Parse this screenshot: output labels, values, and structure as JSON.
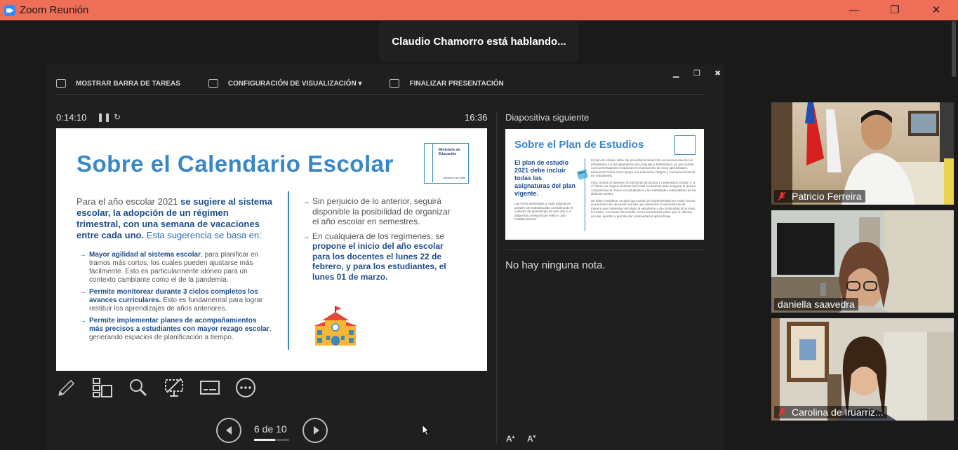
{
  "window": {
    "title": "Zoom Reunión",
    "minimize": "—",
    "restore": "❐",
    "close": "✕"
  },
  "speaking_banner": "Claudio Chamorro está hablando...",
  "presenter_toolbar": {
    "show_taskbar": "MOSTRAR BARRA DE TAREAS",
    "display_settings": "CONFIGURACIÓN DE VISUALIZACIÓN ▾",
    "end_presentation": "FINALIZAR PRESENTACIÓN"
  },
  "timer": "0:14:10",
  "clock": "16:36",
  "next_slide_label": "Diapositiva siguiente",
  "current_slide": {
    "title": "Sobre el Calendario Escolar",
    "gov_line1": "Ministerio de",
    "gov_line2": "Educación",
    "gov_line3": "Gobierno de Chile",
    "intro_a": "Para el año escolar 2021 ",
    "intro_b": "se sugiere al sistema escolar, la adopción de un régimen trimestral, con una semana de vacaciones entre cada uno.",
    "intro_c": " Esta sugerencia se basa en:",
    "bullet1_b": "Mayor agilidad al sistema escolar",
    "bullet1_t": ", para planificar en tramos más cortos, los cuales pueden ajustarse más fácilmente. Esto es particularmente idóneo para un contexto cambiante como el de la pandemia.",
    "bullet2_b": "Permite monitorear durante 3 ciclos completos los avances curriculares.",
    "bullet2_t": " Esto es fundamental para lograr restituir los aprendizajes de años anteriores.",
    "bullet3_b": "Permite implementar planes de acompañamientos más precisos a estudiantes con mayor rezago escolar",
    "bullet3_t": ", generando espacios de planificación a tiempo.",
    "right1": "Sin perjuicio de lo anterior, seguirá disponible la posibilidad de organizar el año escolar en semestres.",
    "right2_a": "En cualquiera de los regímenes, se ",
    "right2_b": "propone el inicio del año escolar para los docentes el lunes 22 de febrero, y para los estudiantes, el lunes 01 de marzo."
  },
  "next_slide": {
    "title": "Sobre el Plan de Estudios",
    "left_bold": "El plan de estudio 2021 debe incluir todas las asignaturas del plan vigente.",
    "left_small": "Las horas destinadas a cada asignatura pueden ser redistribuidas considerando el contexto de aprendizaje de este año y el diagnóstico integral que realice cada establecimiento.",
    "right_p1": "El plan de estudio debe dar prioridad al desarrollo socioemocional de los estudiantes y a las asignaturas de Lenguaje y Matemática, ya que actúan como prerrequisito e impactan en el desarrollo de otros aprendizajes; Educación Física como apoyo a la educación integral y socioemocional de los estudiantes.",
    "right_p2": "Para cumplir el aumento en las horas de lectura y matemática: Desde 1° a 2° básico se sugiere destinar las horas necesarias para asegurar la lectura comprensiva en todos los estudiantes y las habilidades matemáticas de los distintos niveles.",
    "right_p3": "Se debe considerar un plan que pueda ser implementado en modo remoto en períodos de educación remota que determine la autoridad de tal manera que mantenga vinculado al estudiante y de continuidad al proceso formativo. Los textos de estudio son la herramienta clave que el sistema escolar, aportan y permite dar continuidad al aprendizaje."
  },
  "notes_text": "No hay ninguna nota.",
  "page_indicator": "6 de 10",
  "page_progress": 0.6,
  "font_increase": "A",
  "font_decrease": "A",
  "tool_icons": [
    "pen-icon",
    "slides-grid-icon",
    "zoom-icon",
    "black-screen-icon",
    "subtitles-icon",
    "more-icon"
  ],
  "participants": [
    {
      "name": "Patricio Ferreira",
      "muted": true
    },
    {
      "name": "daniella saavedra",
      "muted": false
    },
    {
      "name": "Carolina de Iruarriz...",
      "muted": true
    }
  ],
  "colors": {
    "titlebar": "#ee6e58",
    "slide_blue": "#3a87c8",
    "slide_navy": "#1f4e8c"
  }
}
